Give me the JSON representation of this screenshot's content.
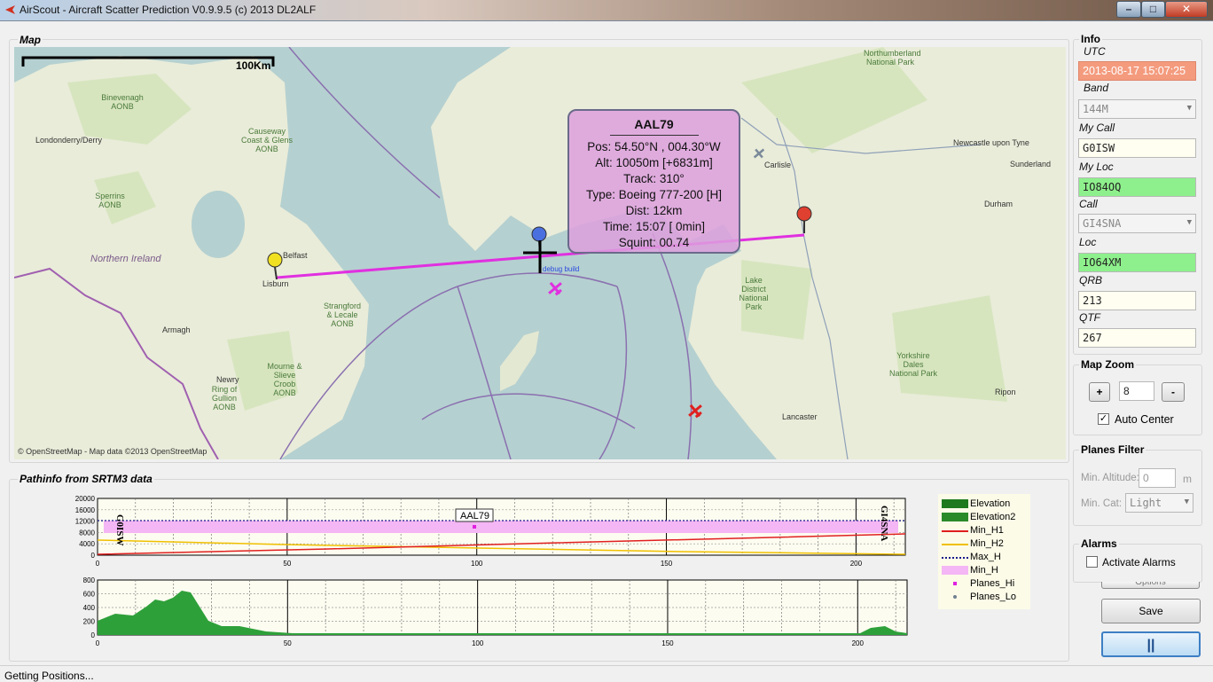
{
  "window": {
    "title": "AirScout - Aircraft Scatter Prediction V0.9.9.5 (c) 2013 DL2ALF",
    "min": "–",
    "max": "□",
    "close": "✕"
  },
  "map_group": {
    "title": "Map",
    "scale": "100Km",
    "attribution": "© OpenStreetMap - Map data ©2013 OpenStreetMap",
    "places": [
      {
        "label": "Londonderry/Derry"
      },
      {
        "label": "Binevenagh AONB"
      },
      {
        "label": "Causeway Coast & Glens AONB"
      },
      {
        "label": "Sperrins AONB"
      },
      {
        "label": "Northern Ireland",
        "big": true
      },
      {
        "label": "Belfast"
      },
      {
        "label": "Lisburn"
      },
      {
        "label": "Armagh"
      },
      {
        "label": "Strangford & Lecale AONB"
      },
      {
        "label": "Newry"
      },
      {
        "label": "Mourne & Slieve Croob AONB"
      },
      {
        "label": "Ring of Gullion AONB"
      },
      {
        "label": "Carlisle"
      },
      {
        "label": "Newcastle upon Tyne"
      },
      {
        "label": "Sunderland"
      },
      {
        "label": "Durham"
      },
      {
        "label": "Lake District National Park"
      },
      {
        "label": "Yorkshire Dales National Park"
      },
      {
        "label": "Ripon"
      },
      {
        "label": "Lancaster"
      },
      {
        "label": "Northumberland National Park"
      }
    ],
    "popup": {
      "title": "AAL79",
      "lines": [
        "Pos: 54.50°N , 004.30°W",
        "Alt: 10050m [+6831m]",
        "Track: 310°",
        "Type: Boeing 777-200 [H]",
        "Dist:  12km",
        "Time: 15:07 [ 0min]",
        "Squint: 00.74"
      ]
    },
    "debug": "debug build"
  },
  "pathinfo": {
    "title": "Pathinfo from SRTM3 data",
    "label_left": "G0ISW",
    "label_right": "GI4SNA",
    "plane_label": "AAL79",
    "top_yticks": [
      "20000",
      "16000",
      "12000",
      "8000",
      "4000",
      "0"
    ],
    "bot_yticks": [
      "800",
      "600",
      "400",
      "200",
      "0"
    ],
    "xticks": [
      "0",
      "50",
      "100",
      "150",
      "200"
    ],
    "legend": [
      {
        "label": "Elevation",
        "color": "#1f7a1f",
        "kind": "area"
      },
      {
        "label": "Elevation2",
        "color": "#2a8a2a",
        "kind": "area"
      },
      {
        "label": "Min_H1",
        "color": "#e02020",
        "kind": "line"
      },
      {
        "label": "Min_H2",
        "color": "#f0c000",
        "kind": "line"
      },
      {
        "label": "Max_H",
        "color": "#1a1a8c",
        "kind": "dotted"
      },
      {
        "label": "Min_H",
        "color": "#f4b6f4",
        "kind": "fill"
      },
      {
        "label": "Planes_Hi",
        "color": "#e020e0",
        "kind": "dot"
      },
      {
        "label": "Planes_Lo",
        "color": "#708090",
        "kind": "dot"
      }
    ]
  },
  "info": {
    "title": "Info",
    "utc_label": "UTC",
    "utc": "2013-08-17 15:07:25",
    "band_label": "Band",
    "band": "144M",
    "mycall_label": "My Call",
    "mycall": "G0ISW",
    "myloc_label": "My Loc",
    "myloc": "IO84OQ",
    "call_label": "Call",
    "call": "GI4SNA",
    "loc_label": "Loc",
    "loc": "IO64XM",
    "qrb_label": "QRB",
    "qrb": "213",
    "qtf_label": "QTF",
    "qtf": "267"
  },
  "zoom": {
    "title": "Map Zoom",
    "plus": "+",
    "minus": "-",
    "value": "8",
    "auto_center": "Auto Center"
  },
  "filter": {
    "title": "Planes Filter",
    "min_alt_label": "Min. Altitude:",
    "min_alt": "0",
    "unit": "m",
    "min_cat_label": "Min. Cat:",
    "min_cat": "Light"
  },
  "alarms": {
    "title": "Alarms",
    "activate": "Activate Alarms",
    "options": "Options"
  },
  "buttons": {
    "save": "Save",
    "pause": "||"
  },
  "status": "Getting Positions..."
}
